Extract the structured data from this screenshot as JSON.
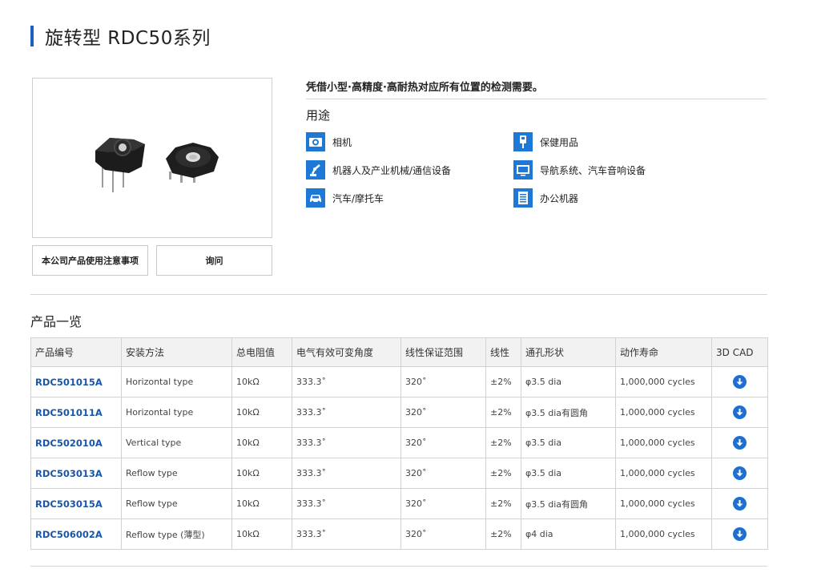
{
  "header": {
    "title": "旋转型 RDC50系列"
  },
  "buttons": {
    "notice": "本公司产品使用注意事项",
    "inquiry": "询问"
  },
  "overview": {
    "tagline": "凭借小型·高精度·高耐热对应所有位置的检测需要。",
    "applications_heading": "用途",
    "applications": [
      {
        "label": "相机",
        "icon": "camera-icon"
      },
      {
        "label": "保健用品",
        "icon": "thermometer-icon"
      },
      {
        "label": "机器人及产业机械/通信设备",
        "icon": "robot-arm-icon"
      },
      {
        "label": "导航系统、汽车音响设备",
        "icon": "monitor-icon"
      },
      {
        "label": "汽车/摩托车",
        "icon": "car-icon"
      },
      {
        "label": "办公机器",
        "icon": "office-machine-icon"
      }
    ]
  },
  "products": {
    "section_title": "产品一览",
    "columns": [
      "产品编号",
      "安装方法",
      "总电阻值",
      "电气有效可变角度",
      "线性保证范围",
      "线性",
      "通孔形状",
      "动作寿命",
      "3D CAD"
    ],
    "rows": [
      {
        "pn": "RDC501015A",
        "mount": "Horizontal type",
        "resistance": "10kΩ",
        "angle": "333.3˚",
        "range": "320˚",
        "linearity": "±2%",
        "hole": "φ3.5 dia",
        "life": "1,000,000 cycles"
      },
      {
        "pn": "RDC501011A",
        "mount": "Horizontal type",
        "resistance": "10kΩ",
        "angle": "333.3˚",
        "range": "320˚",
        "linearity": "±2%",
        "hole": "φ3.5 dia有圆角",
        "life": "1,000,000 cycles"
      },
      {
        "pn": "RDC502010A",
        "mount": "Vertical type",
        "resistance": "10kΩ",
        "angle": "333.3˚",
        "range": "320˚",
        "linearity": "±2%",
        "hole": "φ3.5 dia",
        "life": "1,000,000 cycles"
      },
      {
        "pn": "RDC503013A",
        "mount": "Reflow type",
        "resistance": "10kΩ",
        "angle": "333.3˚",
        "range": "320˚",
        "linearity": "±2%",
        "hole": "φ3.5 dia",
        "life": "1,000,000 cycles"
      },
      {
        "pn": "RDC503015A",
        "mount": "Reflow type",
        "resistance": "10kΩ",
        "angle": "333.3˚",
        "range": "320˚",
        "linearity": "±2%",
        "hole": "φ3.5 dia有圆角",
        "life": "1,000,000 cycles"
      },
      {
        "pn": "RDC506002A",
        "mount": "Reflow type (薄型)",
        "resistance": "10kΩ",
        "angle": "333.3˚",
        "range": "320˚",
        "linearity": "±2%",
        "hole": "φ4 dia",
        "life": "1,000,000 cycles"
      }
    ]
  },
  "colors": {
    "accent": "#1d5fbf",
    "link": "#1a56a8",
    "icon_bg": "#1e78d6"
  }
}
